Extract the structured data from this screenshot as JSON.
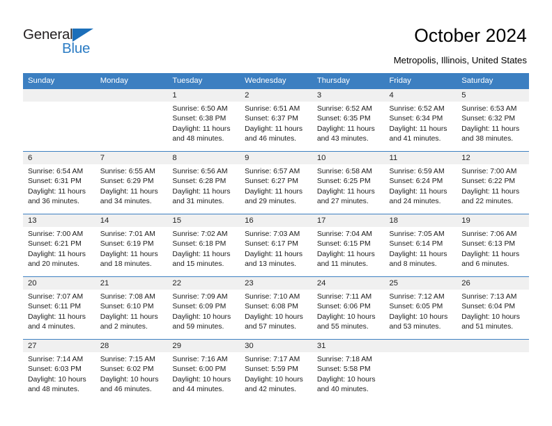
{
  "brand": {
    "name_part1": "General",
    "name_part2": "Blue"
  },
  "header": {
    "title": "October 2024",
    "subtitle": "Metropolis, Illinois, United States"
  },
  "colors": {
    "header_blue": "#3c7fc1",
    "band_gray": "#f0f0f0",
    "logo_blue": "#2b7cc4",
    "text_black": "#000000"
  },
  "weekday_headers": [
    "Sunday",
    "Monday",
    "Tuesday",
    "Wednesday",
    "Thursday",
    "Friday",
    "Saturday"
  ],
  "weeks": [
    [
      {
        "day": "",
        "sunrise": "",
        "sunset": "",
        "daylight1": "",
        "daylight2": "",
        "blank": true
      },
      {
        "day": "",
        "sunrise": "",
        "sunset": "",
        "daylight1": "",
        "daylight2": "",
        "blank": true
      },
      {
        "day": "1",
        "sunrise": "Sunrise: 6:50 AM",
        "sunset": "Sunset: 6:38 PM",
        "daylight1": "Daylight: 11 hours",
        "daylight2": "and 48 minutes."
      },
      {
        "day": "2",
        "sunrise": "Sunrise: 6:51 AM",
        "sunset": "Sunset: 6:37 PM",
        "daylight1": "Daylight: 11 hours",
        "daylight2": "and 46 minutes."
      },
      {
        "day": "3",
        "sunrise": "Sunrise: 6:52 AM",
        "sunset": "Sunset: 6:35 PM",
        "daylight1": "Daylight: 11 hours",
        "daylight2": "and 43 minutes."
      },
      {
        "day": "4",
        "sunrise": "Sunrise: 6:52 AM",
        "sunset": "Sunset: 6:34 PM",
        "daylight1": "Daylight: 11 hours",
        "daylight2": "and 41 minutes."
      },
      {
        "day": "5",
        "sunrise": "Sunrise: 6:53 AM",
        "sunset": "Sunset: 6:32 PM",
        "daylight1": "Daylight: 11 hours",
        "daylight2": "and 38 minutes."
      }
    ],
    [
      {
        "day": "6",
        "sunrise": "Sunrise: 6:54 AM",
        "sunset": "Sunset: 6:31 PM",
        "daylight1": "Daylight: 11 hours",
        "daylight2": "and 36 minutes."
      },
      {
        "day": "7",
        "sunrise": "Sunrise: 6:55 AM",
        "sunset": "Sunset: 6:29 PM",
        "daylight1": "Daylight: 11 hours",
        "daylight2": "and 34 minutes."
      },
      {
        "day": "8",
        "sunrise": "Sunrise: 6:56 AM",
        "sunset": "Sunset: 6:28 PM",
        "daylight1": "Daylight: 11 hours",
        "daylight2": "and 31 minutes."
      },
      {
        "day": "9",
        "sunrise": "Sunrise: 6:57 AM",
        "sunset": "Sunset: 6:27 PM",
        "daylight1": "Daylight: 11 hours",
        "daylight2": "and 29 minutes."
      },
      {
        "day": "10",
        "sunrise": "Sunrise: 6:58 AM",
        "sunset": "Sunset: 6:25 PM",
        "daylight1": "Daylight: 11 hours",
        "daylight2": "and 27 minutes."
      },
      {
        "day": "11",
        "sunrise": "Sunrise: 6:59 AM",
        "sunset": "Sunset: 6:24 PM",
        "daylight1": "Daylight: 11 hours",
        "daylight2": "and 24 minutes."
      },
      {
        "day": "12",
        "sunrise": "Sunrise: 7:00 AM",
        "sunset": "Sunset: 6:22 PM",
        "daylight1": "Daylight: 11 hours",
        "daylight2": "and 22 minutes."
      }
    ],
    [
      {
        "day": "13",
        "sunrise": "Sunrise: 7:00 AM",
        "sunset": "Sunset: 6:21 PM",
        "daylight1": "Daylight: 11 hours",
        "daylight2": "and 20 minutes."
      },
      {
        "day": "14",
        "sunrise": "Sunrise: 7:01 AM",
        "sunset": "Sunset: 6:19 PM",
        "daylight1": "Daylight: 11 hours",
        "daylight2": "and 18 minutes."
      },
      {
        "day": "15",
        "sunrise": "Sunrise: 7:02 AM",
        "sunset": "Sunset: 6:18 PM",
        "daylight1": "Daylight: 11 hours",
        "daylight2": "and 15 minutes."
      },
      {
        "day": "16",
        "sunrise": "Sunrise: 7:03 AM",
        "sunset": "Sunset: 6:17 PM",
        "daylight1": "Daylight: 11 hours",
        "daylight2": "and 13 minutes."
      },
      {
        "day": "17",
        "sunrise": "Sunrise: 7:04 AM",
        "sunset": "Sunset: 6:15 PM",
        "daylight1": "Daylight: 11 hours",
        "daylight2": "and 11 minutes."
      },
      {
        "day": "18",
        "sunrise": "Sunrise: 7:05 AM",
        "sunset": "Sunset: 6:14 PM",
        "daylight1": "Daylight: 11 hours",
        "daylight2": "and 8 minutes."
      },
      {
        "day": "19",
        "sunrise": "Sunrise: 7:06 AM",
        "sunset": "Sunset: 6:13 PM",
        "daylight1": "Daylight: 11 hours",
        "daylight2": "and 6 minutes."
      }
    ],
    [
      {
        "day": "20",
        "sunrise": "Sunrise: 7:07 AM",
        "sunset": "Sunset: 6:11 PM",
        "daylight1": "Daylight: 11 hours",
        "daylight2": "and 4 minutes."
      },
      {
        "day": "21",
        "sunrise": "Sunrise: 7:08 AM",
        "sunset": "Sunset: 6:10 PM",
        "daylight1": "Daylight: 11 hours",
        "daylight2": "and 2 minutes."
      },
      {
        "day": "22",
        "sunrise": "Sunrise: 7:09 AM",
        "sunset": "Sunset: 6:09 PM",
        "daylight1": "Daylight: 10 hours",
        "daylight2": "and 59 minutes."
      },
      {
        "day": "23",
        "sunrise": "Sunrise: 7:10 AM",
        "sunset": "Sunset: 6:08 PM",
        "daylight1": "Daylight: 10 hours",
        "daylight2": "and 57 minutes."
      },
      {
        "day": "24",
        "sunrise": "Sunrise: 7:11 AM",
        "sunset": "Sunset: 6:06 PM",
        "daylight1": "Daylight: 10 hours",
        "daylight2": "and 55 minutes."
      },
      {
        "day": "25",
        "sunrise": "Sunrise: 7:12 AM",
        "sunset": "Sunset: 6:05 PM",
        "daylight1": "Daylight: 10 hours",
        "daylight2": "and 53 minutes."
      },
      {
        "day": "26",
        "sunrise": "Sunrise: 7:13 AM",
        "sunset": "Sunset: 6:04 PM",
        "daylight1": "Daylight: 10 hours",
        "daylight2": "and 51 minutes."
      }
    ],
    [
      {
        "day": "27",
        "sunrise": "Sunrise: 7:14 AM",
        "sunset": "Sunset: 6:03 PM",
        "daylight1": "Daylight: 10 hours",
        "daylight2": "and 48 minutes."
      },
      {
        "day": "28",
        "sunrise": "Sunrise: 7:15 AM",
        "sunset": "Sunset: 6:02 PM",
        "daylight1": "Daylight: 10 hours",
        "daylight2": "and 46 minutes."
      },
      {
        "day": "29",
        "sunrise": "Sunrise: 7:16 AM",
        "sunset": "Sunset: 6:00 PM",
        "daylight1": "Daylight: 10 hours",
        "daylight2": "and 44 minutes."
      },
      {
        "day": "30",
        "sunrise": "Sunrise: 7:17 AM",
        "sunset": "Sunset: 5:59 PM",
        "daylight1": "Daylight: 10 hours",
        "daylight2": "and 42 minutes."
      },
      {
        "day": "31",
        "sunrise": "Sunrise: 7:18 AM",
        "sunset": "Sunset: 5:58 PM",
        "daylight1": "Daylight: 10 hours",
        "daylight2": "and 40 minutes."
      },
      {
        "day": "",
        "sunrise": "",
        "sunset": "",
        "daylight1": "",
        "daylight2": "",
        "blank": true
      },
      {
        "day": "",
        "sunrise": "",
        "sunset": "",
        "daylight1": "",
        "daylight2": "",
        "blank": true
      }
    ]
  ]
}
